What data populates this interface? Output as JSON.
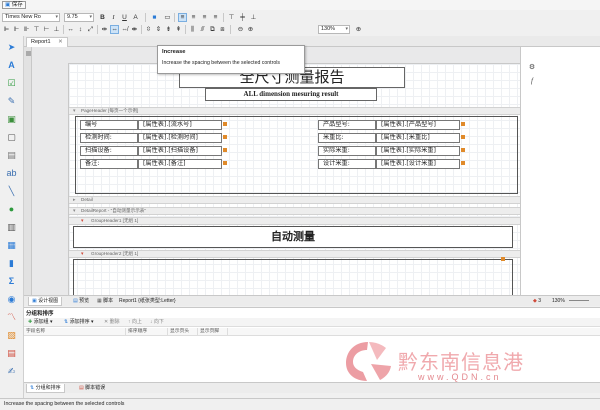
{
  "titlebar": {
    "save_label": "保存"
  },
  "toolbar": {
    "font_name": "Times New Ro",
    "font_size": "9.75",
    "zoom": "130%"
  },
  "tabs": {
    "active": "Report1"
  },
  "tooltip": {
    "title": "Increase",
    "description": "Increase the spacing between the selected controls"
  },
  "report": {
    "title_cn": "全尺寸测量报告",
    "title_en": "ALL dimension mesuring result",
    "bands": {
      "page_header": "PageHeader [每页一个示例]",
      "detail": "Detail",
      "detail_report": "DetailReport - \"自动测量示示表\"",
      "group_header1": "GroupHeader1 [无组 1]",
      "group_header2": "GroupHeader2 [无组 1]"
    },
    "fields_left": [
      {
        "label": "编号",
        "value": "[属性表].[流水号]"
      },
      {
        "label": "检测时间:",
        "value": "[属性表].[检测时间]"
      },
      {
        "label": "扫描设备:",
        "value": "[属性表].[扫描设备]"
      },
      {
        "label": "备注:",
        "value": "[属性表].[备注]"
      }
    ],
    "fields_right": [
      {
        "label": "产品型号:",
        "value": "[属性表].[产品型号]"
      },
      {
        "label": "米重比:",
        "value": "[属性表].[米重比]"
      },
      {
        "label": "实际米重:",
        "value": "[属性表].[实际米重]"
      },
      {
        "label": "设计米重:",
        "value": "[属性表].[设计米重]"
      }
    ],
    "auto_measure": "自动测量"
  },
  "design_tabs": {
    "design": "设计视图",
    "preview": "预览",
    "script": "脚本",
    "info": "Report1 {纸张类型:Letter}",
    "count": "3",
    "zoom": "130%"
  },
  "group_panel": {
    "title": "分组和排序",
    "add_group": "添加组",
    "add_sort": "添加排序",
    "delete": "删除",
    "up": "向上",
    "down": "向下",
    "columns": [
      "字段名称",
      "排序顺序",
      "显示页头",
      "显示页脚"
    ]
  },
  "bottom_tabs": {
    "group_sort": "分组和排序",
    "script_errors": "脚本错误"
  },
  "status": {
    "text": "Increase the spacing between the selected controls"
  },
  "watermark": {
    "text": "黔东南信息港",
    "url": "www.QDN.cn"
  },
  "colors": {
    "accent": "#2b7bd6",
    "marker": "#e08a2a",
    "watermark": "#f0a9ad"
  }
}
